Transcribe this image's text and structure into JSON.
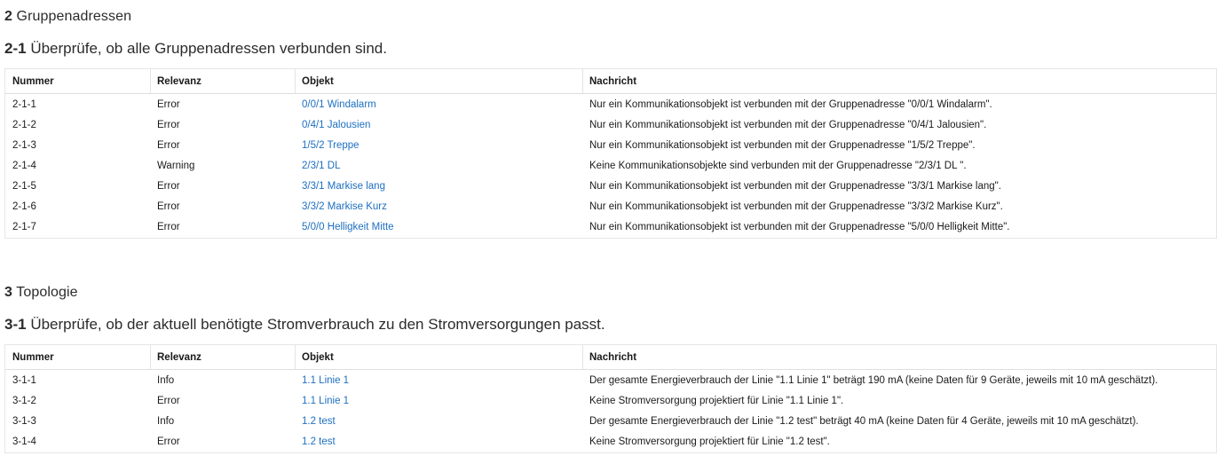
{
  "section2": {
    "number": "2",
    "title": "Gruppenadressen",
    "sub": {
      "number": "2-1",
      "title": "Überprüfe, ob alle Gruppenadressen verbunden sind."
    },
    "columns": [
      "Nummer",
      "Relevanz",
      "Objekt",
      "Nachricht"
    ],
    "rows": [
      {
        "nummer": "2-1-1",
        "relevanz": "Error",
        "objekt": "0/0/1 Windalarm",
        "nachricht": "Nur ein Kommunikationsobjekt ist verbunden mit der Gruppenadresse \"0/0/1 Windalarm\"."
      },
      {
        "nummer": "2-1-2",
        "relevanz": "Error",
        "objekt": "0/4/1 Jalousien",
        "nachricht": "Nur ein Kommunikationsobjekt ist verbunden mit der Gruppenadresse \"0/4/1 Jalousien\"."
      },
      {
        "nummer": "2-1-3",
        "relevanz": "Error",
        "objekt": "1/5/2 Treppe",
        "nachricht": "Nur ein Kommunikationsobjekt ist verbunden mit der Gruppenadresse \"1/5/2 Treppe\"."
      },
      {
        "nummer": "2-1-4",
        "relevanz": "Warning",
        "objekt": "2/3/1 DL",
        "nachricht": "Keine Kommunikationsobjekte sind verbunden mit der Gruppenadresse \"2/3/1 DL \"."
      },
      {
        "nummer": "2-1-5",
        "relevanz": "Error",
        "objekt": "3/3/1 Markise lang",
        "nachricht": "Nur ein Kommunikationsobjekt ist verbunden mit der Gruppenadresse \"3/3/1 Markise lang\"."
      },
      {
        "nummer": "2-1-6",
        "relevanz": "Error",
        "objekt": "3/3/2 Markise Kurz",
        "nachricht": "Nur ein Kommunikationsobjekt ist verbunden mit der Gruppenadresse \"3/3/2 Markise Kurz\"."
      },
      {
        "nummer": "2-1-7",
        "relevanz": "Error",
        "objekt": "5/0/0 Helligkeit Mitte",
        "nachricht": "Nur ein Kommunikationsobjekt ist verbunden mit der Gruppenadresse \"5/0/0 Helligkeit Mitte\"."
      }
    ]
  },
  "section3": {
    "number": "3",
    "title": "Topologie",
    "sub": {
      "number": "3-1",
      "title": "Überprüfe, ob der aktuell benötigte Stromverbrauch zu den Stromversorgungen passt."
    },
    "columns": [
      "Nummer",
      "Relevanz",
      "Objekt",
      "Nachricht"
    ],
    "rows": [
      {
        "nummer": "3-1-1",
        "relevanz": "Info",
        "objekt": "1.1 Linie 1",
        "nachricht": "Der gesamte Energieverbrauch der Linie \"1.1 Linie 1\" beträgt 190 mA (keine Daten für 9 Geräte, jeweils mit 10 mA geschätzt)."
      },
      {
        "nummer": "3-1-2",
        "relevanz": "Error",
        "objekt": "1.1 Linie 1",
        "nachricht": "Keine Stromversorgung projektiert für Linie \"1.1 Linie 1\"."
      },
      {
        "nummer": "3-1-3",
        "relevanz": "Info",
        "objekt": "1.2 test",
        "nachricht": "Der gesamte Energieverbrauch der Linie \"1.2 test\" beträgt 40 mA (keine Daten für 4 Geräte, jeweils mit 10 mA geschätzt)."
      },
      {
        "nummer": "3-1-4",
        "relevanz": "Error",
        "objekt": "1.2 test",
        "nachricht": "Keine Stromversorgung projektiert für Linie \"1.2 test\"."
      }
    ]
  },
  "colors": {
    "link": "#1e6fc1",
    "text": "#1a1a1a",
    "border": "#e6e6e6"
  }
}
